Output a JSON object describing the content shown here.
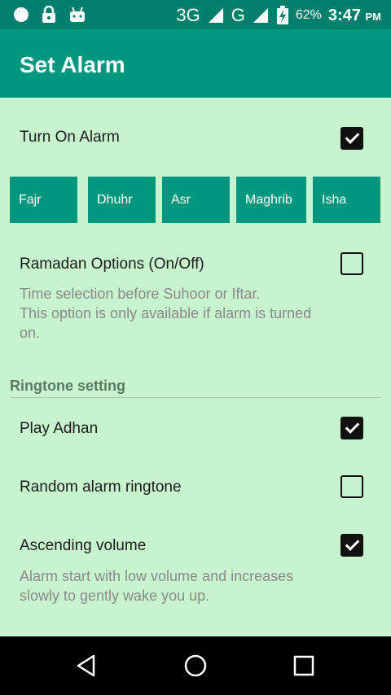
{
  "status_bar": {
    "network_1": "3G",
    "network_2": "G",
    "battery_percent": "62%",
    "time": "3:47",
    "ampm": "PM",
    "icons": [
      "circle-icon",
      "lock-icon",
      "android-icon",
      "signal-icon",
      "battery-charging-icon"
    ]
  },
  "app_bar": {
    "title": "Set Alarm"
  },
  "alarm": {
    "turn_on_label": "Turn On Alarm",
    "turn_on_checked": true,
    "prayers": [
      "Fajr",
      "Dhuhr",
      "Asr",
      "Maghrib",
      "Isha"
    ],
    "ramadan_label": "Ramadan Options (On/Off)",
    "ramadan_checked": false,
    "ramadan_summary_1": "Time selection before Suhoor or Iftar.",
    "ramadan_summary_2": "This option is only available if alarm is turned",
    "ramadan_summary_3": "on."
  },
  "ringtone": {
    "header": "Ringtone setting",
    "play_adhan_label": "Play Adhan",
    "play_adhan_checked": true,
    "random_label": "Random alarm ringtone",
    "random_checked": false,
    "ascending_label": "Ascending volume",
    "ascending_checked": true,
    "ascending_summary_1": "Alarm start with low volume and increases",
    "ascending_summary_2": "slowly to gently wake you up."
  },
  "nav_bar": {
    "icons": [
      "back-icon",
      "home-icon",
      "recents-icon"
    ]
  },
  "colors": {
    "status_bar": "#00806c",
    "app_bar": "#00977f",
    "background": "#c7f3cf",
    "prayer_button": "#00977f"
  }
}
